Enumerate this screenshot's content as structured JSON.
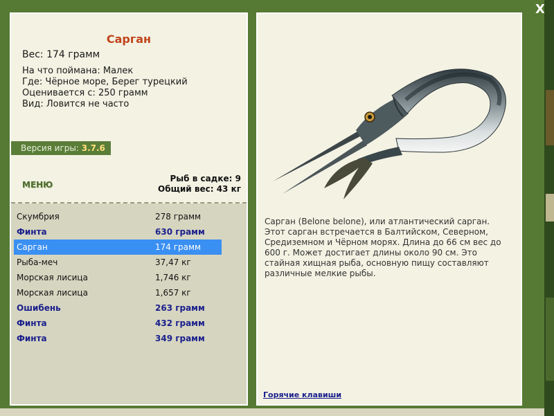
{
  "window": {
    "close_label": "X"
  },
  "fish": {
    "name": "Сарган",
    "weight_line": "Вес: 174 грамм",
    "info": [
      "На что поймана: Малек",
      "Где: Чёрное море, Берег турецкий",
      "Оценивается с: 250 грамм",
      "Вид: Ловится не часто"
    ],
    "description": "Сарган (Belone belone), или атлантический сарган. Этот сарган встречается в Балтийском, Северном, Средиземном и Чёрном морях. Длина до 66 см вес до 600 г. Может достигает длины около 90 см. Это стайная хищная рыба, основную пищу составляют различные мелкие рыбы."
  },
  "version": {
    "label": "Версия игры:",
    "value": "3.7.6"
  },
  "menu_label": "МЕНЮ",
  "keep": {
    "count_line": "Рыб в садке: 9",
    "total_line": "Общий вес: 43 кг"
  },
  "catch": [
    {
      "name": "Скумбрия",
      "weight": "278 грамм",
      "rare": false,
      "selected": false
    },
    {
      "name": "Финта",
      "weight": "630 грамм",
      "rare": true,
      "selected": false
    },
    {
      "name": "Сарган",
      "weight": "174 грамм",
      "rare": false,
      "selected": true
    },
    {
      "name": "Рыба-меч",
      "weight": "37,47 кг",
      "rare": false,
      "selected": false
    },
    {
      "name": "Морская лисица",
      "weight": "1,746 кг",
      "rare": false,
      "selected": false
    },
    {
      "name": "Морская лисица",
      "weight": "1,657 кг",
      "rare": false,
      "selected": false
    },
    {
      "name": "Ошибень",
      "weight": "263 грамм",
      "rare": true,
      "selected": false
    },
    {
      "name": "Финта",
      "weight": "432 грамм",
      "rare": true,
      "selected": false
    },
    {
      "name": "Финта",
      "weight": "349 грамм",
      "rare": true,
      "selected": false
    }
  ],
  "hotkeys_label": "Горячие клавиши",
  "colors": {
    "frame_green": "#567a34",
    "panel_bg": "#f3f2e3",
    "title_orange": "#c0441b",
    "rare_blue": "#1a1f8c",
    "selected_blue": "#3a8ff2"
  }
}
